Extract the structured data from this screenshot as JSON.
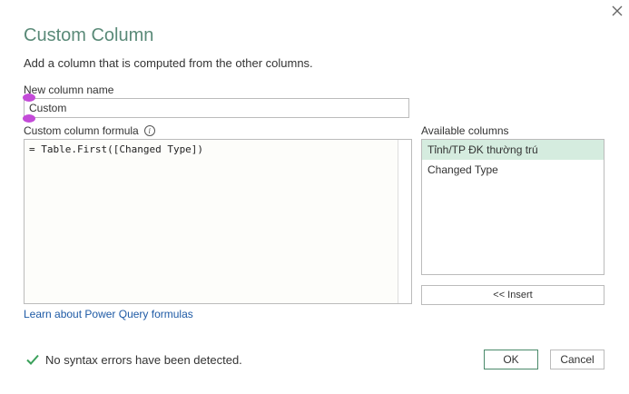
{
  "dialog": {
    "title": "Custom Column",
    "subtitle": "Add a column that is computed from the other columns.",
    "close_icon": "close-icon"
  },
  "name_field": {
    "label": "New column name",
    "value": "Custom"
  },
  "formula": {
    "label": "Custom column formula",
    "info_icon": "info-icon",
    "info_glyph": "i",
    "value": "= Table.First([Changed Type])"
  },
  "learn_link": "Learn about Power Query formulas",
  "available": {
    "label": "Available columns",
    "items": [
      {
        "label": "Tỉnh/TP ĐK thường trú",
        "selected": true
      },
      {
        "label": "Changed Type",
        "selected": false
      }
    ],
    "insert_label": "<< Insert"
  },
  "status": {
    "icon": "check-icon",
    "text": "No syntax errors have been detected."
  },
  "buttons": {
    "ok": "OK",
    "cancel": "Cancel"
  },
  "colors": {
    "title": "#5a8a78",
    "selected_row": "#d5ecdf",
    "link": "#1e5aa5",
    "check": "#3aa05a",
    "handle": "#c34bd8"
  }
}
